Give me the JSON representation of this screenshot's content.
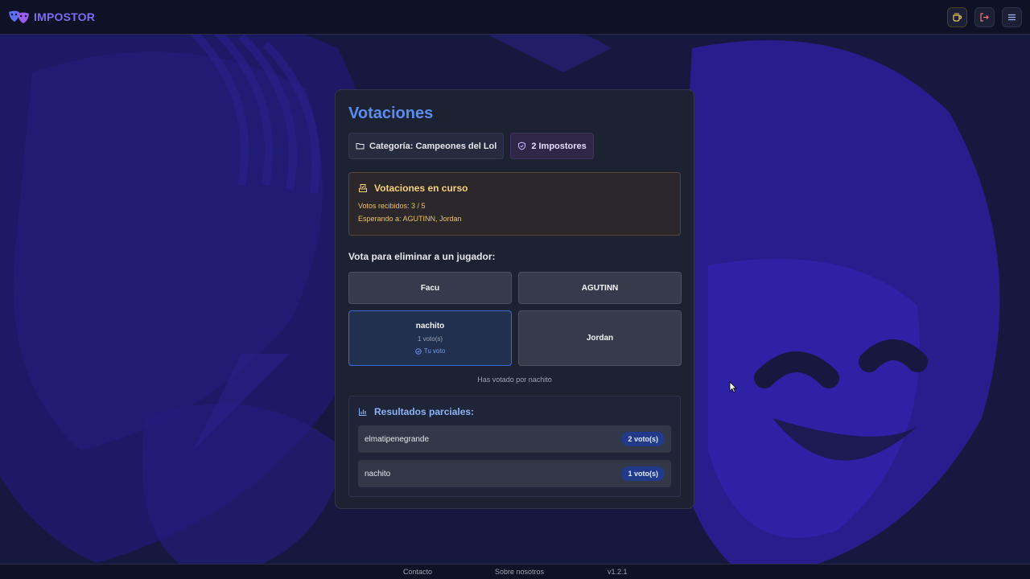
{
  "app": {
    "name": "IMPOSTOR"
  },
  "header": {
    "icons": [
      "coffee-icon",
      "logout-icon",
      "menu-icon"
    ]
  },
  "voting": {
    "title": "Votaciones",
    "category_chip": "Categoría: Campeones del Lol",
    "impostors_chip": "2 Impostores",
    "status": {
      "heading": "Votaciones en curso",
      "received": "Votos recibidos: 3 / 5",
      "waiting": "Esperando a: AGUTINN, Jordan"
    },
    "vote_prompt": "Vota para eliminar a un jugador:",
    "players": [
      {
        "name": "Facu"
      },
      {
        "name": "AGUTINN"
      },
      {
        "name": "nachito",
        "votes": "1 voto(s)",
        "mine": "Tu voto"
      },
      {
        "name": "Jordan"
      }
    ],
    "voted_note": "Has votado por nachito",
    "results": {
      "heading": "Resultados parciales:",
      "rows": [
        {
          "name": "elmatipenegrande",
          "votes": "2 voto(s)"
        },
        {
          "name": "nachito",
          "votes": "1 voto(s)"
        }
      ]
    }
  },
  "footer": {
    "contact": "Contacto",
    "about": "Sobre nosotros",
    "version": "v1.2.1"
  },
  "colors": {
    "background": "#14173a",
    "accent": "#5b8def",
    "warning": "#f7d27a",
    "badge": "#213a8a"
  }
}
